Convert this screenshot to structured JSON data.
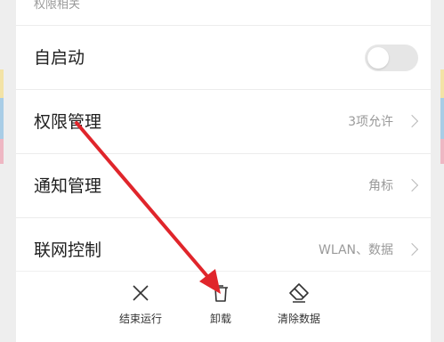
{
  "section_header": "权限相关",
  "rows": [
    {
      "label": "自启动",
      "value": ""
    },
    {
      "label": "权限管理",
      "value": "3项允许"
    },
    {
      "label": "通知管理",
      "value": "角标"
    },
    {
      "label": "联网控制",
      "value": "WLAN、数据"
    }
  ],
  "toggle": {
    "state": "off"
  },
  "actions": [
    {
      "label": "结束运行",
      "icon": "close-x-icon"
    },
    {
      "label": "卸载",
      "icon": "trash-icon"
    },
    {
      "label": "清除数据",
      "icon": "eraser-icon"
    }
  ],
  "colors": {
    "arrow": "#e0252b",
    "stripe_yellow": "#f3e3a6",
    "stripe_blue": "#a9cde6",
    "stripe_pink": "#eeb7c3"
  }
}
